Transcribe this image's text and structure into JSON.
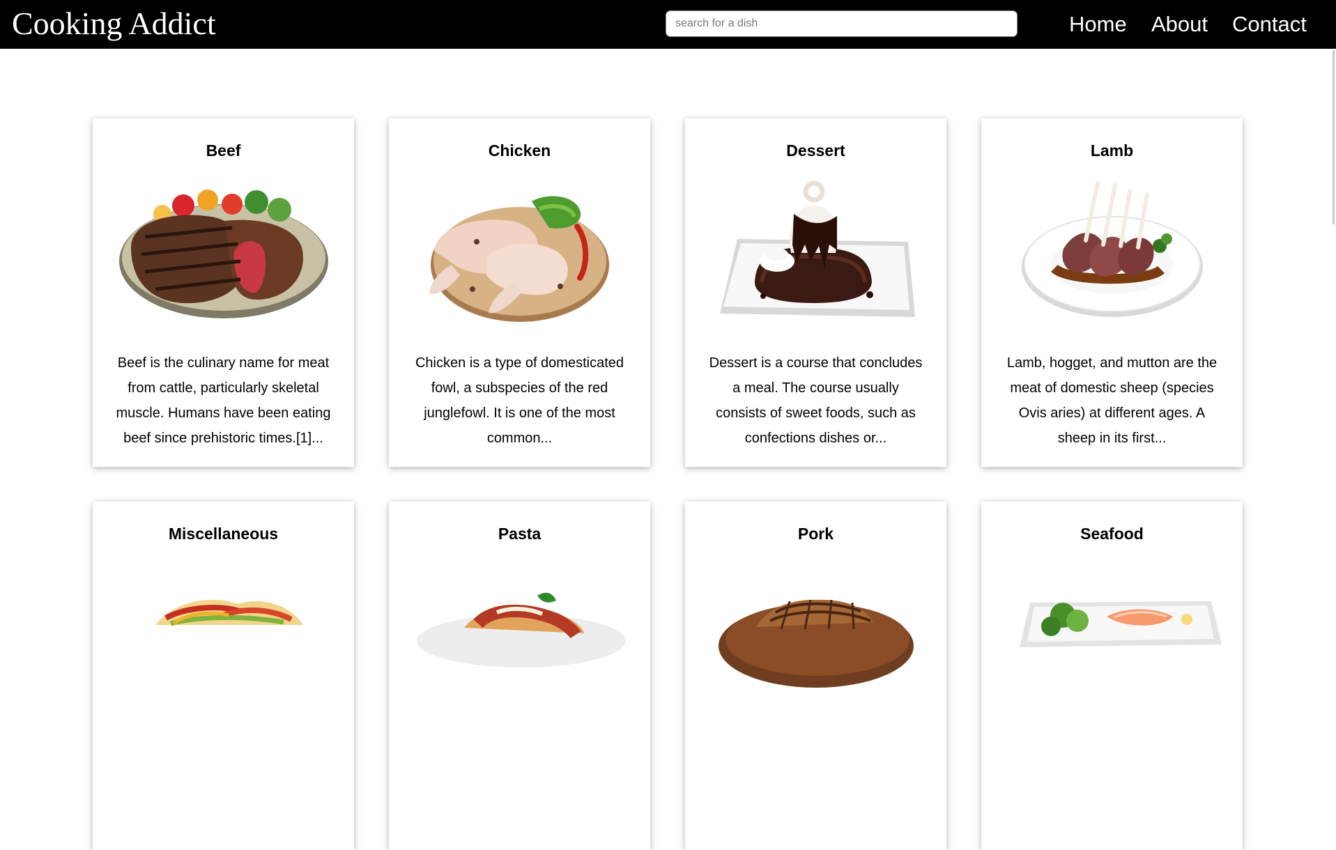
{
  "header": {
    "brand": "Cooking Addict",
    "search_placeholder": "search for a dish",
    "search_value": "",
    "nav": [
      "Home",
      "About",
      "Contact"
    ]
  },
  "categories": [
    {
      "title": "Beef",
      "description": "Beef is the culinary name for meat from cattle, particularly skeletal muscle. Humans have been eating beef since prehistoric times.[1]...",
      "image": "grilled-steak-plate"
    },
    {
      "title": "Chicken",
      "description": "Chicken is a type of domesticated fowl, a subspecies of the red junglefowl. It is one of the most common...",
      "image": "raw-chicken-legs-board"
    },
    {
      "title": "Dessert",
      "description": "Dessert is a course that concludes a meal. The course usually consists of sweet foods, such as confections dishes or...",
      "image": "chocolate-cake-dessert"
    },
    {
      "title": "Lamb",
      "description": "Lamb, hogget, and mutton are the meat of domestic sheep (species Ovis aries) at different ages.  A sheep in its first...",
      "image": "lamb-rack-plate"
    },
    {
      "title": "Miscellaneous",
      "description": "",
      "image": "tacos"
    },
    {
      "title": "Pasta",
      "description": "",
      "image": "pasta-bolognese"
    },
    {
      "title": "Pork",
      "description": "",
      "image": "grilled-pork-chop"
    },
    {
      "title": "Seafood",
      "description": "",
      "image": "salmon-salad-plate"
    }
  ],
  "colors": {
    "header_bg": "#000000",
    "page_bg": "#ffffff",
    "text": "#000000"
  }
}
